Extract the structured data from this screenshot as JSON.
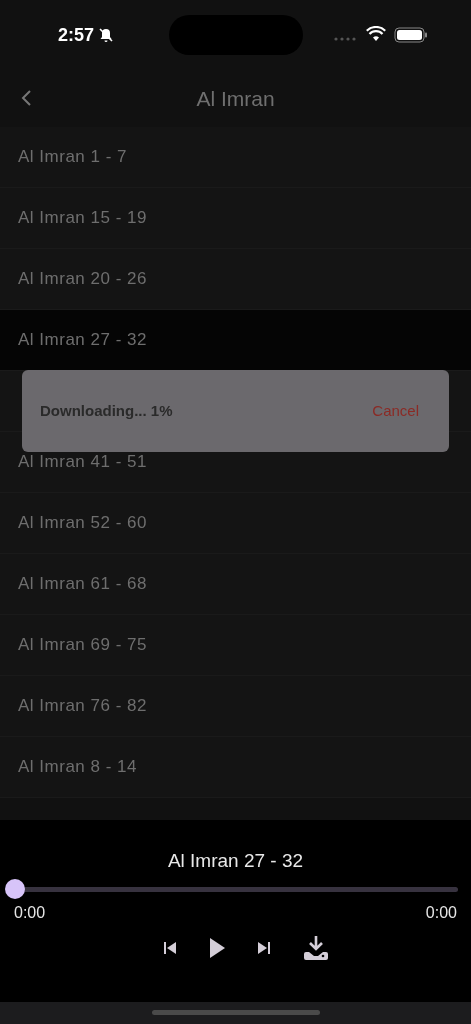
{
  "status_bar": {
    "time": "2:57"
  },
  "nav": {
    "title": "Al Imran"
  },
  "items": [
    {
      "label": "Al Imran 1 - 7",
      "selected": false
    },
    {
      "label": "Al Imran 15 - 19",
      "selected": false
    },
    {
      "label": "Al Imran 20 - 26",
      "selected": false
    },
    {
      "label": "Al Imran 27 - 32",
      "selected": true
    },
    {
      "selected": false
    },
    {
      "label": "Al Imran 41 - 51",
      "selected": false
    },
    {
      "label": "Al Imran 52 - 60",
      "selected": false
    },
    {
      "label": "Al Imran 61 - 68",
      "selected": false
    },
    {
      "label": "Al Imran 69 - 75",
      "selected": false
    },
    {
      "label": "Al Imran 76 - 82",
      "selected": false
    },
    {
      "label": "Al Imran 8 - 14",
      "selected": false
    }
  ],
  "toast": {
    "message": "Downloading... 1%",
    "action": "Cancel"
  },
  "player": {
    "title": "Al Imran 27 - 32",
    "level": 0,
    "elapsed": "0:00",
    "duration": "0:00"
  }
}
